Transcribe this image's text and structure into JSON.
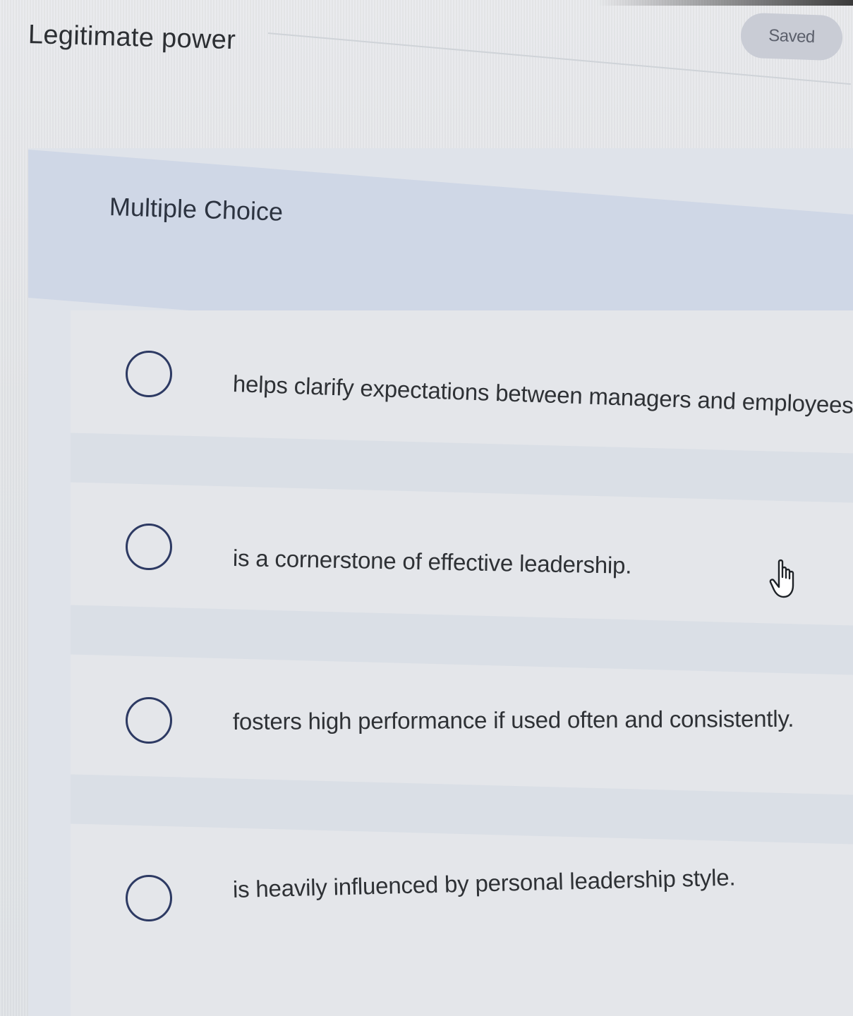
{
  "question": {
    "title": "Legitimate power",
    "status_badge": "Saved",
    "type_label": "Multiple Choice"
  },
  "options": [
    {
      "label": "helps clarify expectations between managers and employees.",
      "selected": false
    },
    {
      "label": "is a cornerstone of effective leadership.",
      "selected": false
    },
    {
      "label": "fosters high performance if used often and consistently.",
      "selected": false
    },
    {
      "label": "is heavily influenced by personal leadership style.",
      "selected": false
    }
  ],
  "cursor": {
    "icon": "hand-pointer-icon"
  },
  "colors": {
    "radio_border": "#2d3a63",
    "badge_bg": "#c9ccd5",
    "band_bg": "#cfd7e6"
  }
}
